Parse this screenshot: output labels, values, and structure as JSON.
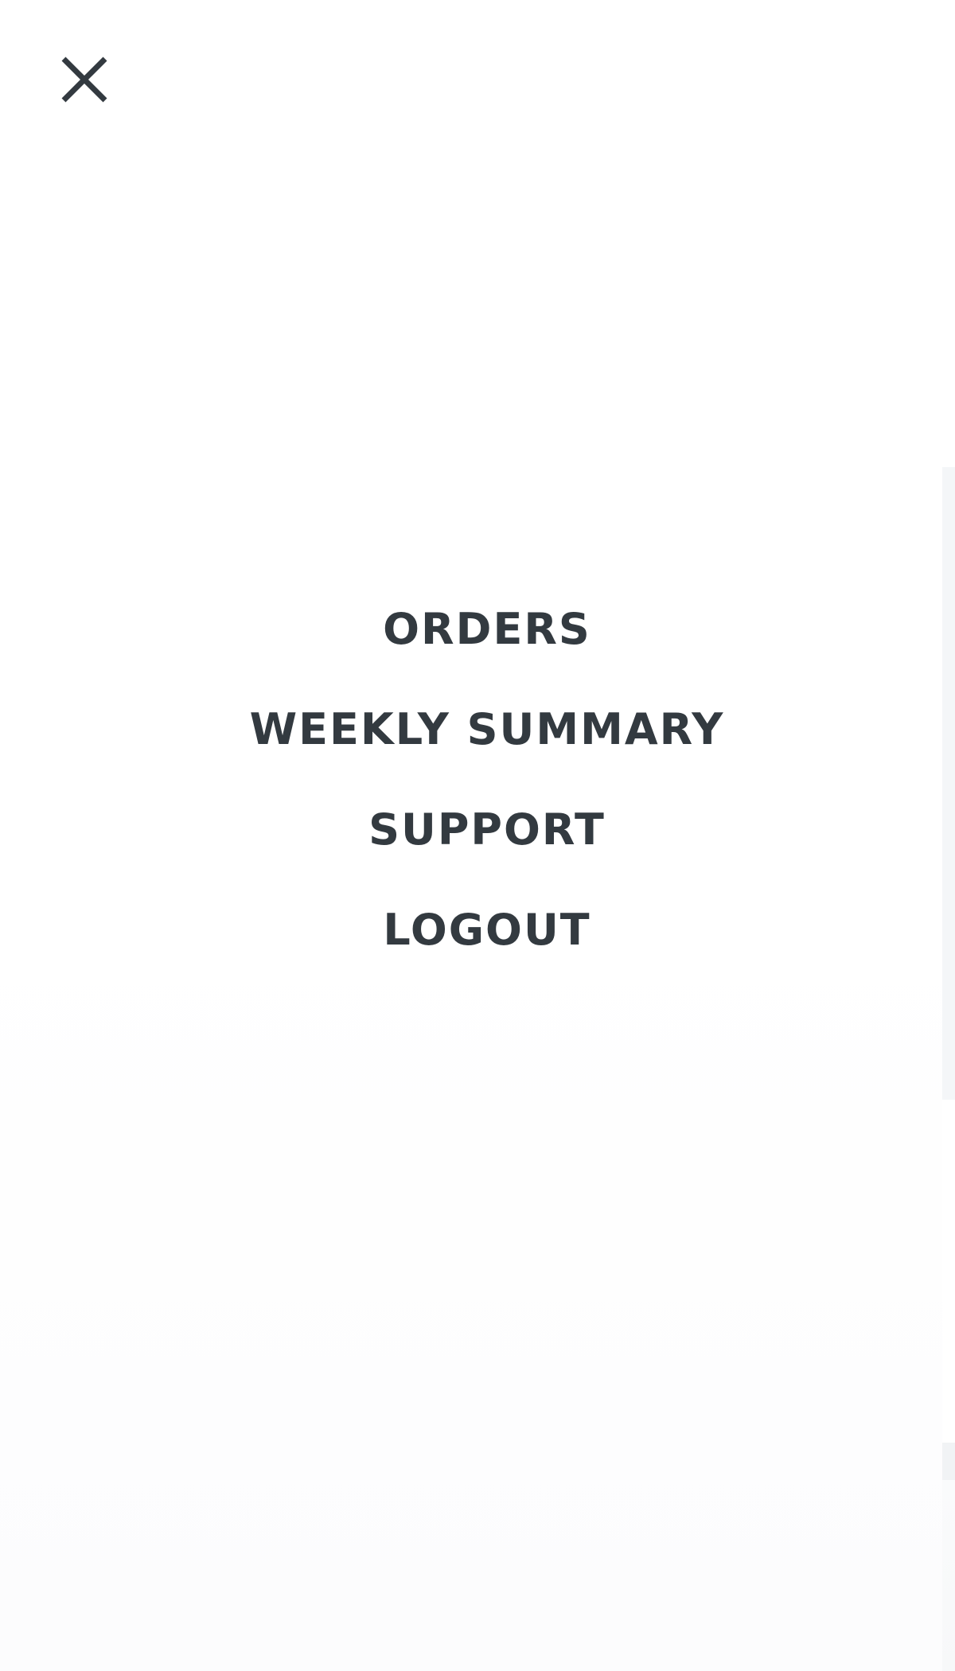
{
  "menu": {
    "close_icon": "close-icon",
    "items": [
      {
        "label": "ORDERS"
      },
      {
        "label": "WEEKLY SUMMARY"
      },
      {
        "label": "SUPPORT"
      },
      {
        "label": "LOGOUT"
      }
    ]
  },
  "colors": {
    "text": "#333a40",
    "background": "#ffffff"
  }
}
